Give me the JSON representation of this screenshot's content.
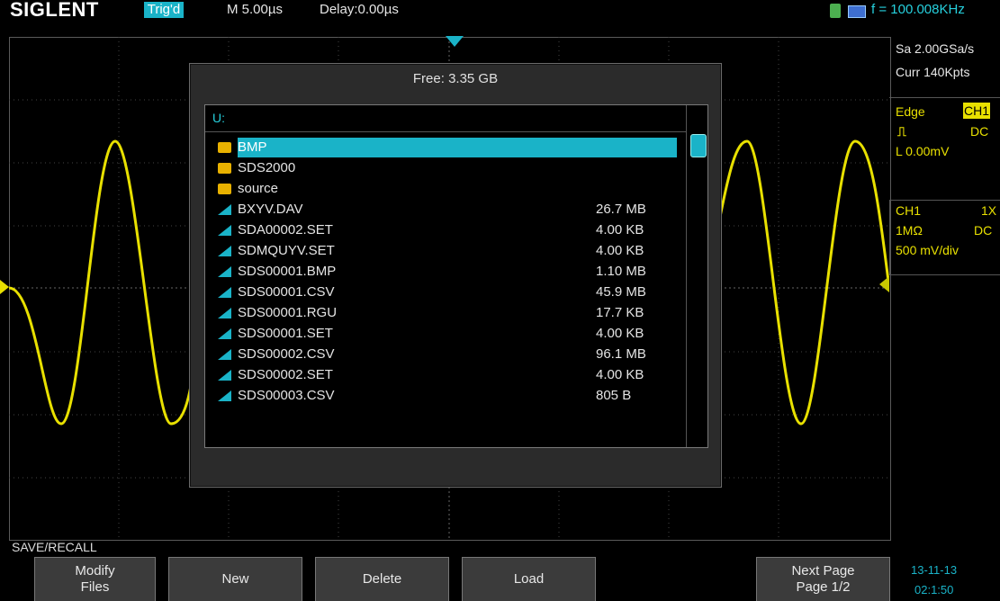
{
  "topbar": {
    "brand": "SIGLENT",
    "trigger_status": "Trig'd",
    "timebase": "M 5.00µs",
    "delay": "Delay:0.00µs",
    "frequency": "f = 100.008KHz"
  },
  "side": {
    "sample_rate": "Sa 2.00GSa/s",
    "memory": "Curr 140Kpts",
    "trigger_type": "Edge",
    "trigger_source": "CH1",
    "coupling": "DC",
    "level": "L  0.00mV",
    "channel": "CH1",
    "probe": "1X",
    "impedance": "1MΩ",
    "ch_coupling": "DC",
    "scale": "500 mV/div"
  },
  "dialog": {
    "free_space": "Free: 3.35 GB",
    "drive": "U:",
    "files": [
      {
        "name": "BMP",
        "size": "",
        "type": "folder",
        "selected": true
      },
      {
        "name": "SDS2000",
        "size": "",
        "type": "folder"
      },
      {
        "name": "source",
        "size": "",
        "type": "folder"
      },
      {
        "name": "BXYV.DAV",
        "size": "26.7 MB",
        "type": "file"
      },
      {
        "name": "SDA00002.SET",
        "size": "4.00 KB",
        "type": "file"
      },
      {
        "name": "SDMQUYV.SET",
        "size": "4.00 KB",
        "type": "file"
      },
      {
        "name": "SDS00001.BMP",
        "size": "1.10 MB",
        "type": "file"
      },
      {
        "name": "SDS00001.CSV",
        "size": "45.9 MB",
        "type": "file"
      },
      {
        "name": "SDS00001.RGU",
        "size": "17.7 KB",
        "type": "file"
      },
      {
        "name": "SDS00001.SET",
        "size": "4.00 KB",
        "type": "file"
      },
      {
        "name": "SDS00002.CSV",
        "size": "96.1 MB",
        "type": "file"
      },
      {
        "name": "SDS00002.SET",
        "size": "4.00 KB",
        "type": "file"
      },
      {
        "name": "SDS00003.CSV",
        "size": "805 B",
        "type": "file"
      }
    ]
  },
  "menu": {
    "title": "SAVE/RECALL",
    "modify_1": "Modify",
    "modify_2": "Files",
    "new": "New",
    "delete": "Delete",
    "load": "Load",
    "next_1": "Next Page",
    "next_2": "Page 1/2"
  },
  "datetime": {
    "date": "13-11-13",
    "time": "02:1:50"
  },
  "colors": {
    "accent": "#1ab3c8",
    "trace": "#e8e000",
    "folder": "#e8b100"
  }
}
